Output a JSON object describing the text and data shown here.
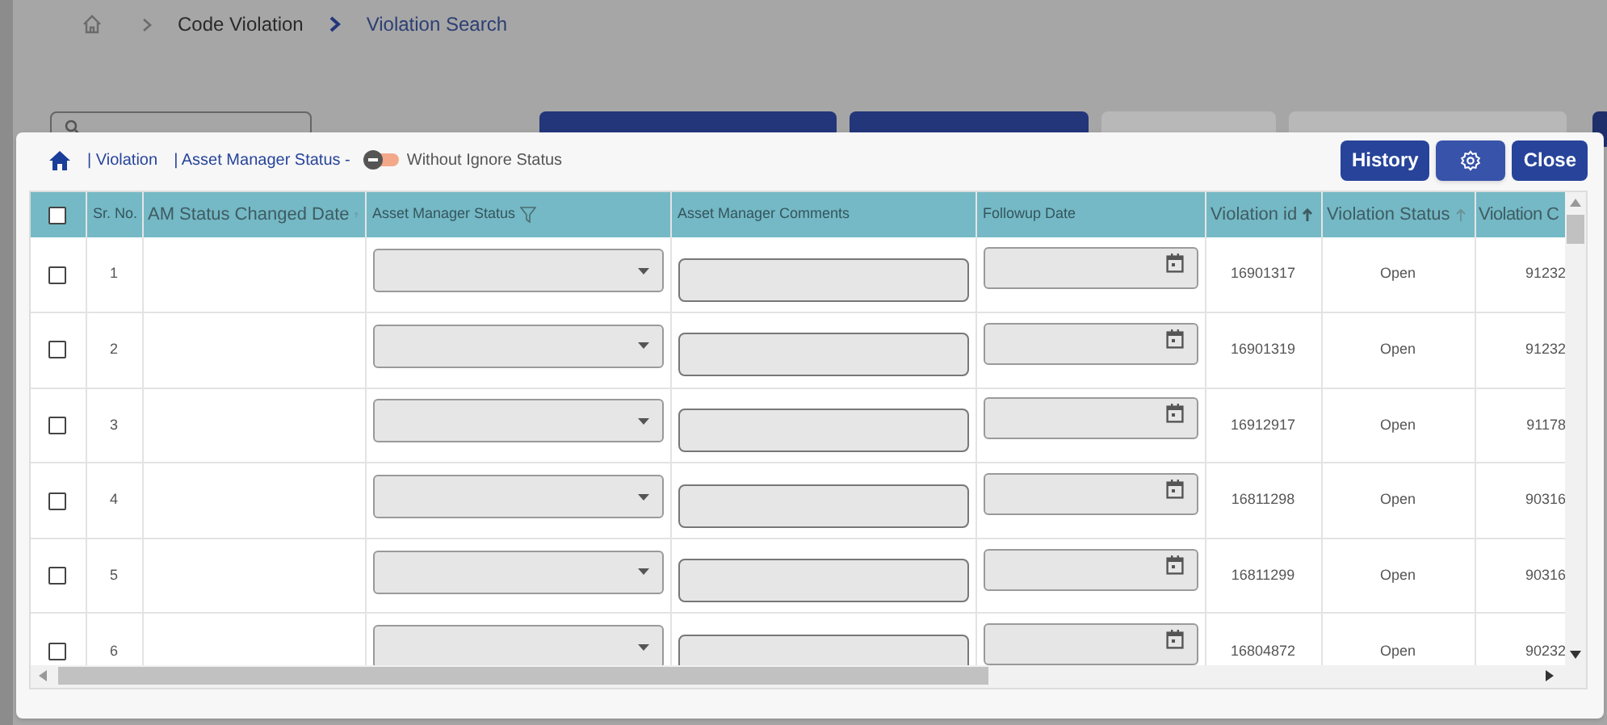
{
  "breadcrumb": [
    "Code Violation",
    "Violation Search"
  ],
  "toolbar_buttons": [
    {
      "disabled": false
    },
    {
      "disabled": false
    },
    {
      "disabled": true
    },
    {
      "disabled": true
    }
  ],
  "dialog": {
    "crumbs": [
      "| Violation",
      "| Asset Manager Status -"
    ],
    "toggle": {
      "label": "Without Ignore Status",
      "on": false
    },
    "buttons": [
      {
        "kind": "text",
        "label": "History"
      },
      {
        "kind": "settings"
      },
      {
        "kind": "text",
        "label": "Close"
      }
    ]
  },
  "table": {
    "all_checked": false,
    "columns": [
      {
        "kind": "check"
      },
      {
        "label": "Sr. No.",
        "small": true
      },
      {
        "label": "AM Status Changed Date",
        "small": false
      },
      {
        "label": "Asset Manager Status",
        "small": true
      },
      {
        "label": "Asset Manager Comments",
        "small": true
      },
      {
        "label": "Followup Date",
        "small": true
      },
      {
        "label": "Violation id",
        "small": false
      },
      {
        "label": "Violation Status",
        "small": false
      },
      {
        "label": "Violation C",
        "small": false
      }
    ],
    "rows": [
      {
        "checked": false,
        "sr": "1",
        "violation_id": "16901317",
        "status": "Open",
        "column_9": "91232"
      },
      {
        "checked": false,
        "sr": "2",
        "violation_id": "16901319",
        "status": "Open",
        "column_9": "91232"
      },
      {
        "checked": false,
        "sr": "3",
        "violation_id": "16912917",
        "status": "Open",
        "column_9": "91178"
      },
      {
        "checked": false,
        "sr": "4",
        "violation_id": "16811298",
        "status": "Open",
        "column_9": "90316"
      },
      {
        "checked": false,
        "sr": "5",
        "violation_id": "16811299",
        "status": "Open",
        "column_9": "90316"
      },
      {
        "checked": false,
        "sr": "6",
        "violation_id": "16804872",
        "status": "Open",
        "column_9": "90232"
      }
    ]
  }
}
